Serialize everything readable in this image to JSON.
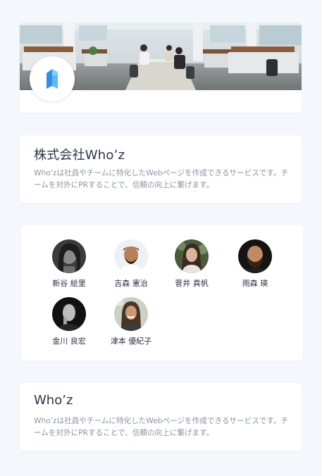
{
  "company": {
    "name": "株式会社Who’z",
    "description": "Who’zは社員やチームに特化したWebページを作成できるサービスです。チームを対外にPRすることで、信頼の向上に繋げます。"
  },
  "members": [
    {
      "name": "新谷 絵里"
    },
    {
      "name": "吉森 憲治"
    },
    {
      "name": "菅井 真帆"
    },
    {
      "name": "雨森 瑛"
    },
    {
      "name": "金川 良宏"
    },
    {
      "name": "津本 優紀子"
    }
  ],
  "about": {
    "title": "Who’z",
    "description": "Who’zは社員やチームに特化したWebページを作成できるサービスです。チームを対外にPRすることで、信頼の向上に繋げます。"
  },
  "icons": {
    "logo": "whoz-logo-icon"
  },
  "colors": {
    "background": "#f4f7fb",
    "card": "#ffffff",
    "text_primary": "#2b3646",
    "text_secondary": "#8b95a3",
    "logo_blue": "#2f8ee6",
    "logo_light": "#7fd0f5"
  }
}
